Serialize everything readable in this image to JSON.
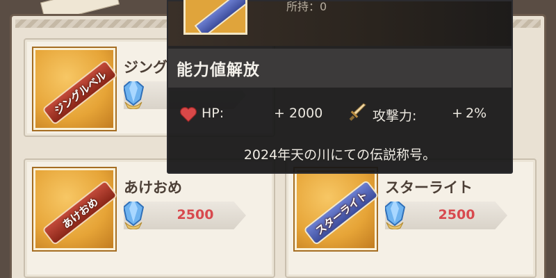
{
  "shop": {
    "items": [
      {
        "name": "ジングルベル",
        "name_visible": "ジング",
        "price": "",
        "badge_text": "ジングルベル"
      },
      {
        "name": "あけおめ",
        "price": "2500",
        "badge_text": "あけおめ"
      },
      {
        "name": "スターライト",
        "price": "2500",
        "badge_text": "スターライト"
      }
    ]
  },
  "tooltip": {
    "subtitle": "所持：0",
    "section_title": "能力値解放",
    "stats": [
      {
        "icon": "heart-icon",
        "label": "HP:",
        "sign": "+",
        "value": "2000"
      },
      {
        "icon": "sword-icon",
        "label": "攻撃力:",
        "sign": "+",
        "value": "2%"
      }
    ],
    "description": "2024年天の川にての伝説称号。"
  },
  "colors": {
    "price": "#d8494e",
    "tooltip_bg": "#141416",
    "heart": "#d94848",
    "sword": "#e2bf7c"
  }
}
